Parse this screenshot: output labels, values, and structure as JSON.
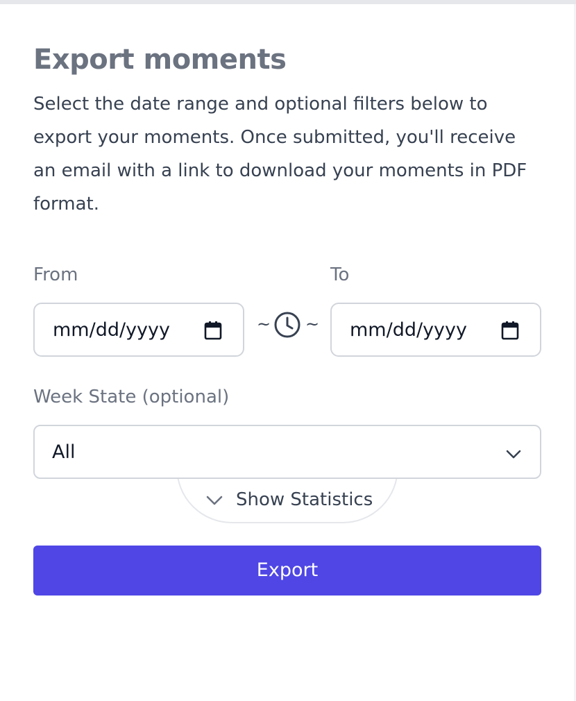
{
  "page": {
    "title": "Export moments",
    "description": "Select the date range and optional filters below to export your moments. Once submitted, you'll receive an email with a link to download your moments in PDF format."
  },
  "date_range": {
    "from_label": "From",
    "to_label": "To",
    "from_placeholder": "mm/dd/yyyy",
    "to_placeholder": "mm/dd/yyyy",
    "separator_left": "~",
    "separator_right": "~",
    "separator_icon": "clock-icon",
    "input_icon": "calendar-icon"
  },
  "week_state": {
    "label": "Week State (optional)",
    "selected": "All",
    "icon": "chevron-down-icon"
  },
  "statistics": {
    "label": "Show Statistics",
    "icon": "chevron-down-icon"
  },
  "actions": {
    "export_label": "Export"
  },
  "colors": {
    "primary": "#4f46e5",
    "title": "#6b7280",
    "label": "#6b7280",
    "text": "#374151",
    "border": "#d1d5db"
  }
}
